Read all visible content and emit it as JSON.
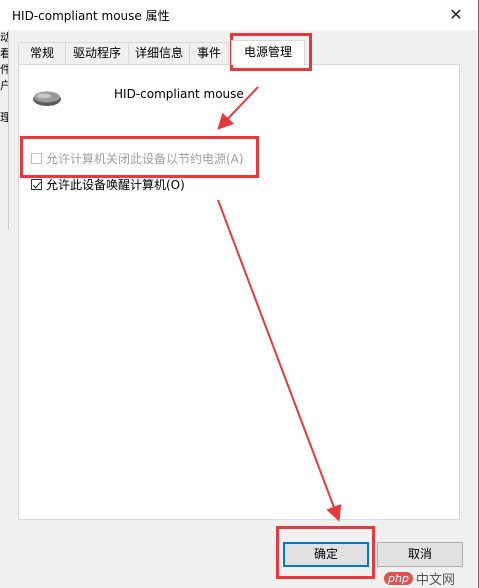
{
  "window": {
    "title": "HID-compliant mouse 属性",
    "close_glyph": "✕"
  },
  "background_window": {
    "fragments": [
      "动",
      "看",
      "件",
      "户",
      "",
      "理",
      "",
      "",
      "",
      "ℝ"
    ]
  },
  "tabs": [
    {
      "label": "常规",
      "active": false
    },
    {
      "label": "驱动程序",
      "active": false
    },
    {
      "label": "详细信息",
      "active": false
    },
    {
      "label": "事件",
      "active": false
    },
    {
      "label": "电源管理",
      "active": true
    }
  ],
  "device": {
    "icon": "mouse-icon",
    "name": "HID-compliant mouse"
  },
  "options": {
    "allow_power_off": {
      "label": "允许计算机关闭此设备以节约电源(A)",
      "checked": false,
      "enabled": false
    },
    "allow_wake": {
      "label": "允许此设备唤醒计算机(O)",
      "checked": true,
      "enabled": true
    }
  },
  "buttons": {
    "ok": "确定",
    "cancel": "取消"
  },
  "watermark": {
    "badge": "php",
    "text": "中文网"
  },
  "colors": {
    "highlight": "#e8383d",
    "focus": "#0078d7"
  }
}
